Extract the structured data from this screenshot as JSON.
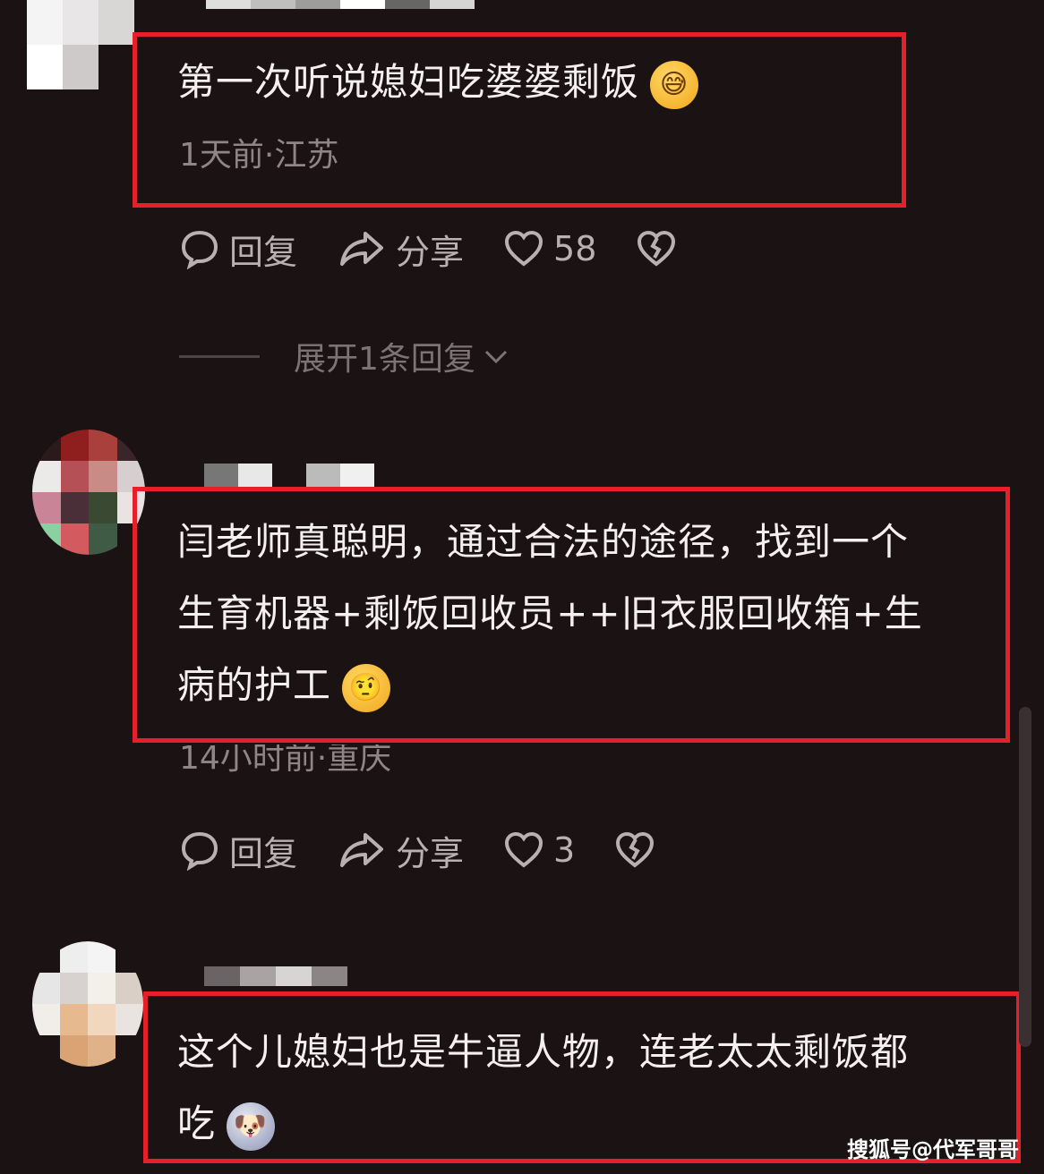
{
  "comments": [
    {
      "text": "第一次听说媳妇吃婆婆剩饭",
      "emoji": "😅",
      "meta": "1天前·江苏",
      "actions": {
        "reply": "回复",
        "share": "分享",
        "likes": "58"
      },
      "expand": "展开1条回复"
    },
    {
      "text_lines": [
        "闫老师真聪明，通过合法的途径，找到一个",
        "生育机器+剩饭回收员++旧衣服回收箱+生",
        "病的护工"
      ],
      "emoji": "🤨",
      "meta": "14小时前·重庆",
      "actions": {
        "reply": "回复",
        "share": "分享",
        "likes": "3"
      }
    },
    {
      "text_lines": [
        "这个儿媳妇也是牛逼人物，连老太太剩饭都",
        "吃"
      ],
      "emoji": "🐶"
    }
  ],
  "watermark": "搜狐号@代军哥哥",
  "icons": [
    "comment-icon",
    "share-icon",
    "heart-icon",
    "broken-heart-icon",
    "chevron-down-icon"
  ],
  "colors": {
    "highlight_box": "#e5202a",
    "background": "#1b1214"
  }
}
